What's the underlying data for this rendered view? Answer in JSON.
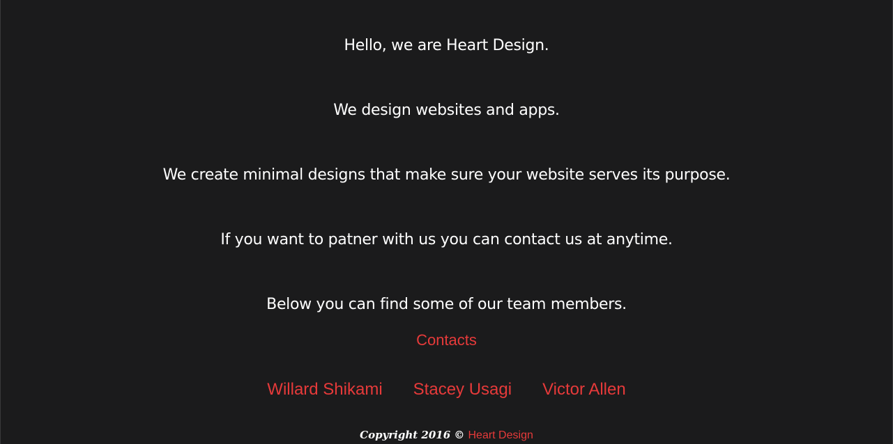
{
  "intro": {
    "line1": "Hello, we are Heart Design.",
    "line2": "We design websites and apps.",
    "line3": "We create minimal designs that make sure your website serves its purpose.",
    "line4": "If you want to patner with us you can contact us at anytime.",
    "line5": "Below you can find some of our team members."
  },
  "contacts": {
    "heading": "Contacts",
    "members": [
      {
        "name": "Willard Shikami"
      },
      {
        "name": "Stacey Usagi"
      },
      {
        "name": "Victor Allen"
      }
    ]
  },
  "footer": {
    "copyright": "Copyright 2016 ©",
    "brand": "Heart Design"
  },
  "colors": {
    "background": "#1b1b1c",
    "text": "#ffffff",
    "accent": "#e63a3a"
  }
}
